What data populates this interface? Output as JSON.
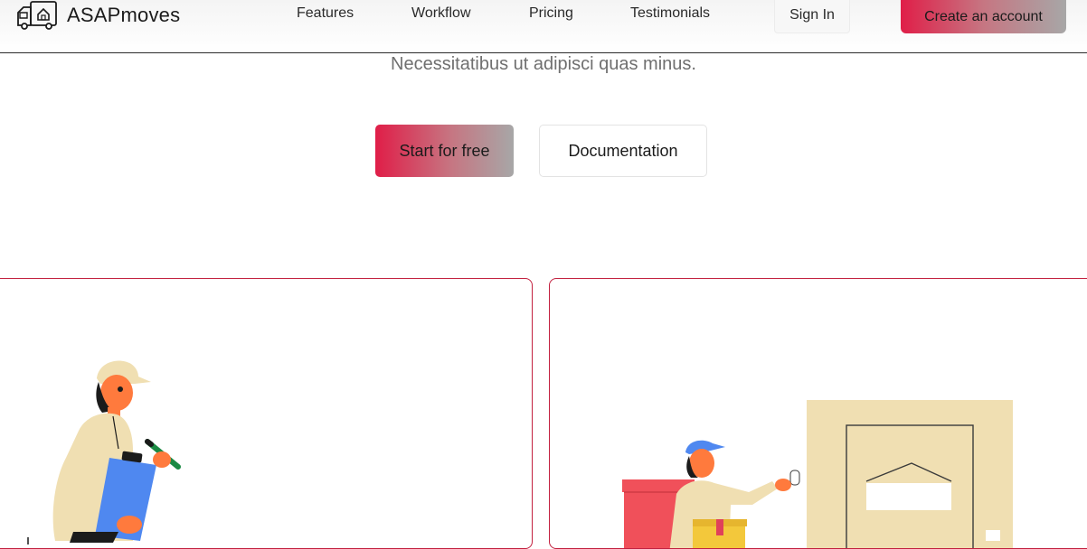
{
  "header": {
    "brand": "ASAPmoves",
    "logo_icon": "moving-truck-icon",
    "nav": [
      "Features",
      "Workflow",
      "Pricing",
      "Testimonials"
    ],
    "sign_in": "Sign In",
    "create_account": "Create an account"
  },
  "hero": {
    "subtitle": "Necessitatibus ut adipisci quas minus.",
    "primary_cta": "Start for free",
    "secondary_cta": "Documentation"
  },
  "cards": [
    {
      "illustration": "mover-with-clipboard"
    },
    {
      "illustration": "courier-at-door-with-boxes"
    }
  ],
  "colors": {
    "accent": "#e01e48",
    "accent_gradient_end": "#a7a7a7",
    "card_border": "#c2203f",
    "text_muted": "#6f6f6f"
  }
}
